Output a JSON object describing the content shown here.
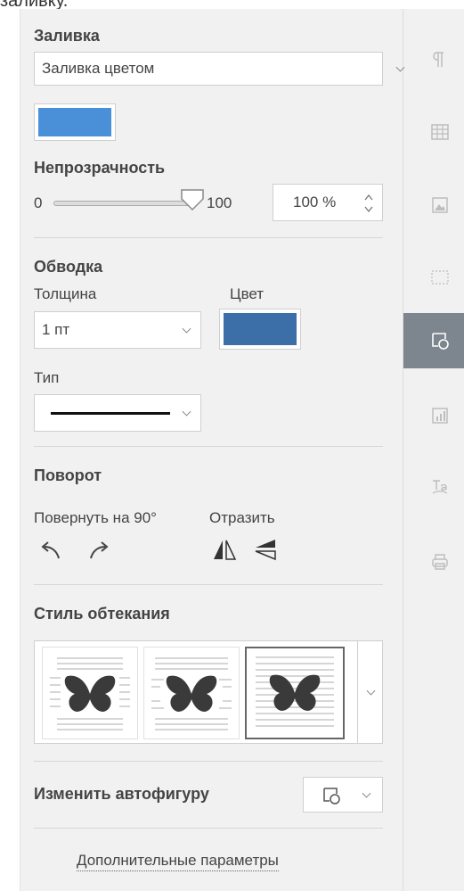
{
  "top_clipped_text": "заливку.",
  "fill": {
    "title": "Заливка",
    "type_value": "Заливка цветом",
    "color": "#4a90d9"
  },
  "opacity": {
    "title": "Непрозрачность",
    "min_label": "0",
    "max_label": "100",
    "value": 100,
    "input_value": "100 %"
  },
  "stroke": {
    "title": "Обводка",
    "width_label": "Толщина",
    "width_value": "1 пт",
    "color_label": "Цвет",
    "color": "#3c6ea8",
    "type_label": "Тип"
  },
  "rotation": {
    "title": "Поворот",
    "rotate_label": "Повернуть на 90°",
    "flip_label": "Отразить"
  },
  "wrapping": {
    "title": "Стиль обтекания",
    "selected_index": 2
  },
  "change_shape": {
    "label": "Изменить автофигуру"
  },
  "advanced_link": "Дополнительные параметры",
  "rightbar": {
    "icons": [
      "paragraph-icon",
      "table-icon",
      "image-icon",
      "header-footer-icon",
      "shape-icon",
      "chart-icon",
      "textart-icon",
      "mail-merge-icon"
    ],
    "active": "shape-icon"
  },
  "colors": {
    "panel_bg": "#f1f1f1",
    "active_tab": "#7d858e"
  }
}
